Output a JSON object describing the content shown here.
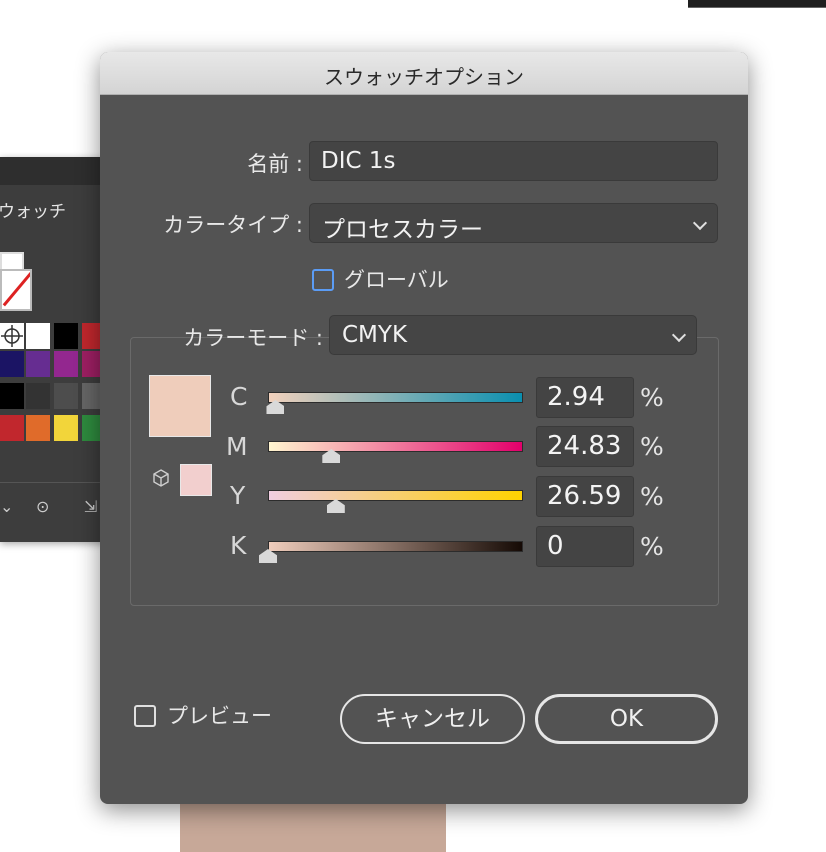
{
  "background_panel": {
    "tab_label": "ウォッチ",
    "swatch_colors": [
      "#ffffff",
      "#000000",
      "#c1272d",
      "#1b1464",
      "#662d91",
      "#93278f",
      "#9e1f63",
      "#000000",
      "#333333",
      "#4d4d4d",
      "#666666",
      "#c1272d",
      "#e06b2a",
      "#f2d53a",
      "#2e8b3e"
    ]
  },
  "dialog": {
    "title": "スウォッチオプション",
    "name_label": "名前 :",
    "name_value": "DIC 1s",
    "color_type_label": "カラータイプ :",
    "color_type_value": "プロセスカラー",
    "global_label": "グローバル",
    "global_checked": false,
    "color_mode_label": "カラーモード :",
    "color_mode_value": "CMYK",
    "preview_color": "#efcdbb",
    "gamut_color": "#f2cfce",
    "channels": [
      {
        "label": "C",
        "value": "2.94",
        "unit": "%",
        "level": 0.0294,
        "gradient": [
          "#f2d1bc",
          "#0a8fb0"
        ]
      },
      {
        "label": "M",
        "value": "24.83",
        "unit": "%",
        "level": 0.2483,
        "gradient": [
          "#fff5cf",
          "#e2006b"
        ]
      },
      {
        "label": "Y",
        "value": "26.59",
        "unit": "%",
        "level": 0.2659,
        "gradient": [
          "#f0cde1",
          "#ffd200"
        ]
      },
      {
        "label": "K",
        "value": "0",
        "unit": "%",
        "level": 0.0,
        "gradient": [
          "#f0cdbc",
          "#150a05"
        ]
      }
    ],
    "preview_label": "プレビュー",
    "preview_checked": false,
    "cancel_label": "キャンセル",
    "ok_label": "OK"
  }
}
